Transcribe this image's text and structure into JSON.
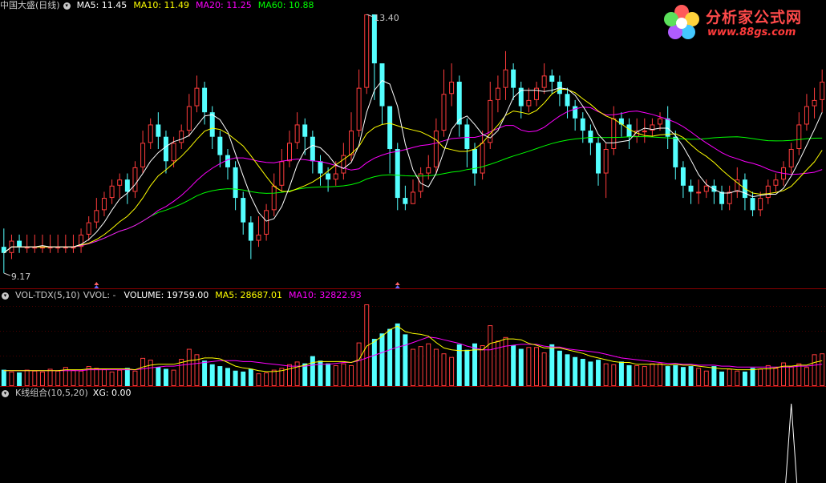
{
  "main_header": {
    "stock": "中国大盛(日线)",
    "ma5": "MA5: 11.45",
    "ma10": "MA10: 11.49",
    "ma20": "MA20: 11.25",
    "ma60": "MA60: 10.88"
  },
  "vol_header": {
    "name": "VOL-TDX(5,10)",
    "vvol": "VVOL: -",
    "volume": "VOLUME: 19759.00",
    "ma5": "MA5: 28687.01",
    "ma10": "MA10: 32822.93"
  },
  "ind_header": {
    "name": "K线组合(10,5,20)",
    "xg": "XG: 0.00"
  },
  "logo": {
    "title": "分析家公式网",
    "url": "www.88gs.com"
  },
  "colors": {
    "up": "#ff3c3c",
    "down": "#54ffff",
    "ma5": "#ffffff",
    "ma10": "#ffff00",
    "ma20": "#ff00ff",
    "ma60": "#00ff00",
    "grid": "#8b0000",
    "hdr_label": "#c8c8c8"
  },
  "chart_data": {
    "type": "candlestick",
    "title": "中国大盛(日线)",
    "high_label": "13.40",
    "low_label": "9.17",
    "price_range": [
      9.17,
      13.4
    ],
    "candles": [
      [
        9.6,
        9.5,
        9.9,
        9.17
      ],
      [
        9.5,
        9.7,
        9.8,
        9.4
      ],
      [
        9.7,
        9.6,
        9.8,
        9.5
      ],
      [
        9.6,
        9.6,
        9.8,
        9.5
      ],
      [
        9.6,
        9.6,
        9.8,
        9.5
      ],
      [
        9.6,
        9.6,
        9.8,
        9.5
      ],
      [
        9.6,
        9.6,
        9.8,
        9.5
      ],
      [
        9.6,
        9.6,
        9.8,
        9.5
      ],
      [
        9.6,
        9.6,
        9.8,
        9.5
      ],
      [
        9.6,
        9.6,
        9.8,
        9.5
      ],
      [
        9.6,
        9.8,
        9.9,
        9.5
      ],
      [
        9.8,
        10.0,
        10.1,
        9.7
      ],
      [
        10.0,
        10.2,
        10.4,
        9.9
      ],
      [
        10.2,
        10.4,
        10.5,
        10.1
      ],
      [
        10.4,
        10.6,
        10.7,
        10.3
      ],
      [
        10.6,
        10.7,
        10.8,
        10.4
      ],
      [
        10.7,
        10.5,
        10.8,
        10.3
      ],
      [
        10.5,
        10.9,
        11.0,
        10.4
      ],
      [
        10.9,
        11.3,
        11.5,
        10.8
      ],
      [
        11.3,
        11.6,
        11.7,
        11.2
      ],
      [
        11.6,
        11.4,
        11.8,
        11.2
      ],
      [
        11.4,
        11.0,
        11.5,
        10.8
      ],
      [
        11.0,
        11.3,
        11.4,
        10.9
      ],
      [
        11.3,
        11.5,
        11.6,
        11.2
      ],
      [
        11.5,
        11.9,
        12.1,
        11.4
      ],
      [
        11.9,
        12.2,
        12.4,
        11.8
      ],
      [
        12.2,
        11.8,
        12.3,
        11.6
      ],
      [
        11.8,
        11.4,
        11.9,
        11.2
      ],
      [
        11.4,
        11.1,
        11.5,
        10.9
      ],
      [
        11.1,
        10.9,
        11.2,
        10.7
      ],
      [
        10.9,
        10.4,
        11.0,
        10.2
      ],
      [
        10.4,
        10.0,
        10.5,
        9.8
      ],
      [
        10.0,
        9.7,
        10.1,
        9.4
      ],
      [
        9.7,
        9.8,
        10.1,
        9.6
      ],
      [
        9.8,
        10.2,
        10.3,
        9.7
      ],
      [
        10.2,
        10.6,
        10.8,
        10.1
      ],
      [
        10.6,
        11.0,
        11.2,
        10.5
      ],
      [
        11.0,
        11.3,
        11.5,
        10.9
      ],
      [
        11.3,
        11.6,
        11.8,
        11.2
      ],
      [
        11.6,
        11.4,
        11.7,
        11.1
      ],
      [
        11.4,
        11.0,
        11.5,
        10.8
      ],
      [
        11.0,
        10.8,
        11.1,
        10.6
      ],
      [
        10.8,
        10.7,
        10.9,
        10.5
      ],
      [
        10.7,
        10.8,
        11.0,
        10.6
      ],
      [
        10.8,
        11.1,
        11.3,
        10.7
      ],
      [
        11.1,
        11.5,
        11.8,
        11.0
      ],
      [
        11.5,
        12.2,
        12.5,
        11.4
      ],
      [
        12.2,
        13.4,
        13.4,
        12.1
      ],
      [
        13.4,
        12.6,
        12.8,
        12.0
      ],
      [
        12.6,
        11.9,
        12.0,
        11.6
      ],
      [
        11.9,
        11.2,
        11.9,
        10.8
      ],
      [
        11.2,
        10.4,
        11.3,
        10.2
      ],
      [
        10.4,
        10.3,
        10.6,
        10.2
      ],
      [
        10.3,
        10.5,
        10.7,
        10.3
      ],
      [
        10.5,
        10.8,
        10.9,
        10.4
      ],
      [
        10.8,
        10.9,
        11.1,
        10.7
      ],
      [
        10.9,
        11.5,
        11.7,
        10.8
      ],
      [
        11.5,
        12.1,
        12.5,
        11.4
      ],
      [
        12.1,
        12.3,
        12.6,
        11.9
      ],
      [
        12.3,
        11.6,
        12.4,
        11.4
      ],
      [
        11.6,
        11.2,
        11.7,
        10.9
      ],
      [
        11.2,
        10.8,
        11.3,
        10.6
      ],
      [
        10.8,
        11.3,
        11.5,
        10.7
      ],
      [
        11.3,
        12.0,
        12.3,
        11.2
      ],
      [
        12.0,
        12.2,
        12.4,
        11.8
      ],
      [
        12.2,
        12.5,
        12.8,
        12.0
      ],
      [
        12.5,
        12.2,
        12.6,
        12.0
      ],
      [
        12.2,
        11.9,
        12.3,
        11.7
      ],
      [
        11.9,
        12.0,
        12.2,
        11.8
      ],
      [
        12.0,
        12.2,
        12.3,
        11.9
      ],
      [
        12.2,
        12.4,
        12.6,
        12.1
      ],
      [
        12.4,
        12.3,
        12.5,
        12.1
      ],
      [
        12.3,
        12.1,
        12.4,
        11.9
      ],
      [
        12.1,
        11.9,
        12.2,
        11.7
      ],
      [
        11.9,
        11.7,
        12.0,
        11.5
      ],
      [
        11.7,
        11.5,
        11.8,
        11.3
      ],
      [
        11.5,
        11.3,
        11.6,
        11.1
      ],
      [
        11.3,
        10.8,
        11.4,
        10.6
      ],
      [
        10.8,
        11.2,
        11.3,
        10.4
      ],
      [
        11.2,
        11.7,
        11.9,
        11.1
      ],
      [
        11.7,
        11.6,
        11.8,
        11.4
      ],
      [
        11.6,
        11.4,
        11.7,
        11.2
      ],
      [
        11.4,
        11.5,
        11.7,
        11.3
      ],
      [
        11.5,
        11.5,
        11.7,
        11.3
      ],
      [
        11.5,
        11.6,
        11.7,
        11.4
      ],
      [
        11.6,
        11.7,
        11.8,
        11.5
      ],
      [
        11.7,
        11.4,
        11.9,
        11.2
      ],
      [
        11.4,
        10.9,
        11.5,
        10.7
      ],
      [
        10.9,
        10.6,
        11.0,
        10.4
      ],
      [
        10.6,
        10.5,
        10.7,
        10.3
      ],
      [
        10.5,
        10.5,
        10.7,
        10.3
      ],
      [
        10.5,
        10.6,
        10.7,
        10.4
      ],
      [
        10.6,
        10.5,
        10.7,
        10.3
      ],
      [
        10.5,
        10.3,
        10.6,
        10.2
      ],
      [
        10.3,
        10.5,
        10.6,
        10.2
      ],
      [
        10.5,
        10.7,
        10.9,
        10.4
      ],
      [
        10.7,
        10.4,
        10.8,
        10.2
      ],
      [
        10.4,
        10.2,
        10.5,
        10.1
      ],
      [
        10.2,
        10.4,
        10.5,
        10.1
      ],
      [
        10.4,
        10.6,
        10.7,
        10.3
      ],
      [
        10.6,
        10.7,
        10.8,
        10.5
      ],
      [
        10.7,
        10.9,
        11.0,
        10.6
      ],
      [
        10.9,
        11.2,
        11.3,
        10.8
      ],
      [
        11.2,
        11.6,
        11.8,
        11.1
      ],
      [
        11.6,
        11.9,
        12.1,
        11.5
      ],
      [
        11.9,
        12.0,
        12.2,
        11.7
      ],
      [
        12.0,
        12.3,
        12.5,
        11.8
      ]
    ],
    "volume": [
      18,
      16,
      15,
      18,
      17,
      16,
      19,
      17,
      21,
      18,
      17,
      22,
      20,
      19,
      16,
      18,
      20,
      17,
      31,
      29,
      21,
      19,
      18,
      30,
      41,
      35,
      28,
      24,
      22,
      20,
      17,
      16,
      19,
      14,
      15,
      18,
      20,
      24,
      27,
      25,
      33,
      28,
      25,
      23,
      25,
      23,
      48,
      90,
      52,
      58,
      63,
      69,
      57,
      41,
      44,
      47,
      41,
      36,
      32,
      46,
      40,
      47,
      45,
      67,
      50,
      54,
      45,
      41,
      43,
      43,
      37,
      46,
      39,
      35,
      32,
      30,
      27,
      29,
      25,
      24,
      27,
      23,
      23,
      22,
      25,
      25,
      22,
      23,
      21,
      22,
      20,
      17,
      22,
      16,
      19,
      17,
      16,
      20,
      19,
      23,
      20,
      26,
      22,
      25,
      21,
      35,
      36
    ],
    "vol_ma5": [
      17,
      17,
      17,
      17,
      17,
      17,
      17,
      17,
      18,
      18,
      18,
      19,
      19,
      19,
      19,
      19,
      19,
      18,
      21,
      23,
      24,
      24,
      24,
      26,
      28,
      29,
      31,
      31,
      30,
      26,
      22,
      20,
      19,
      17,
      16,
      16,
      17,
      19,
      21,
      23,
      26,
      27,
      27,
      27,
      27,
      26,
      29,
      44,
      49,
      55,
      62,
      66,
      60,
      58,
      57,
      55,
      48,
      42,
      40,
      39,
      39,
      40,
      40,
      47,
      49,
      52,
      52,
      51,
      47,
      45,
      42,
      42,
      42,
      40,
      38,
      36,
      33,
      31,
      29,
      27,
      26,
      26,
      24,
      24,
      24,
      24,
      23,
      24,
      23,
      23,
      22,
      21,
      20,
      19,
      19,
      18,
      18,
      18,
      19,
      19,
      20,
      22,
      22,
      23,
      23,
      26,
      28
    ],
    "vol_ma10": [
      17,
      17,
      17,
      17,
      17,
      17,
      17,
      17,
      17,
      17,
      17,
      18,
      18,
      18,
      18,
      18,
      18,
      18,
      19,
      20,
      21,
      22,
      22,
      23,
      24,
      25,
      26,
      27,
      28,
      28,
      28,
      27,
      27,
      26,
      25,
      24,
      23,
      22,
      22,
      22,
      23,
      24,
      24,
      25,
      26,
      26,
      28,
      31,
      34,
      37,
      40,
      43,
      45,
      48,
      51,
      54,
      53,
      51,
      49,
      47,
      44,
      42,
      40,
      40,
      42,
      44,
      45,
      46,
      46,
      46,
      44,
      43,
      43,
      41,
      40,
      39,
      38,
      37,
      35,
      33,
      31,
      30,
      29,
      28,
      27,
      26,
      25,
      25,
      24,
      24,
      23,
      23,
      23,
      22,
      22,
      21,
      21,
      21,
      21,
      21,
      21,
      21,
      21,
      22,
      22,
      23,
      24
    ],
    "xg_signal_index": 102,
    "xg_signal_value": 1.0,
    "markers": [
      12,
      51
    ]
  }
}
